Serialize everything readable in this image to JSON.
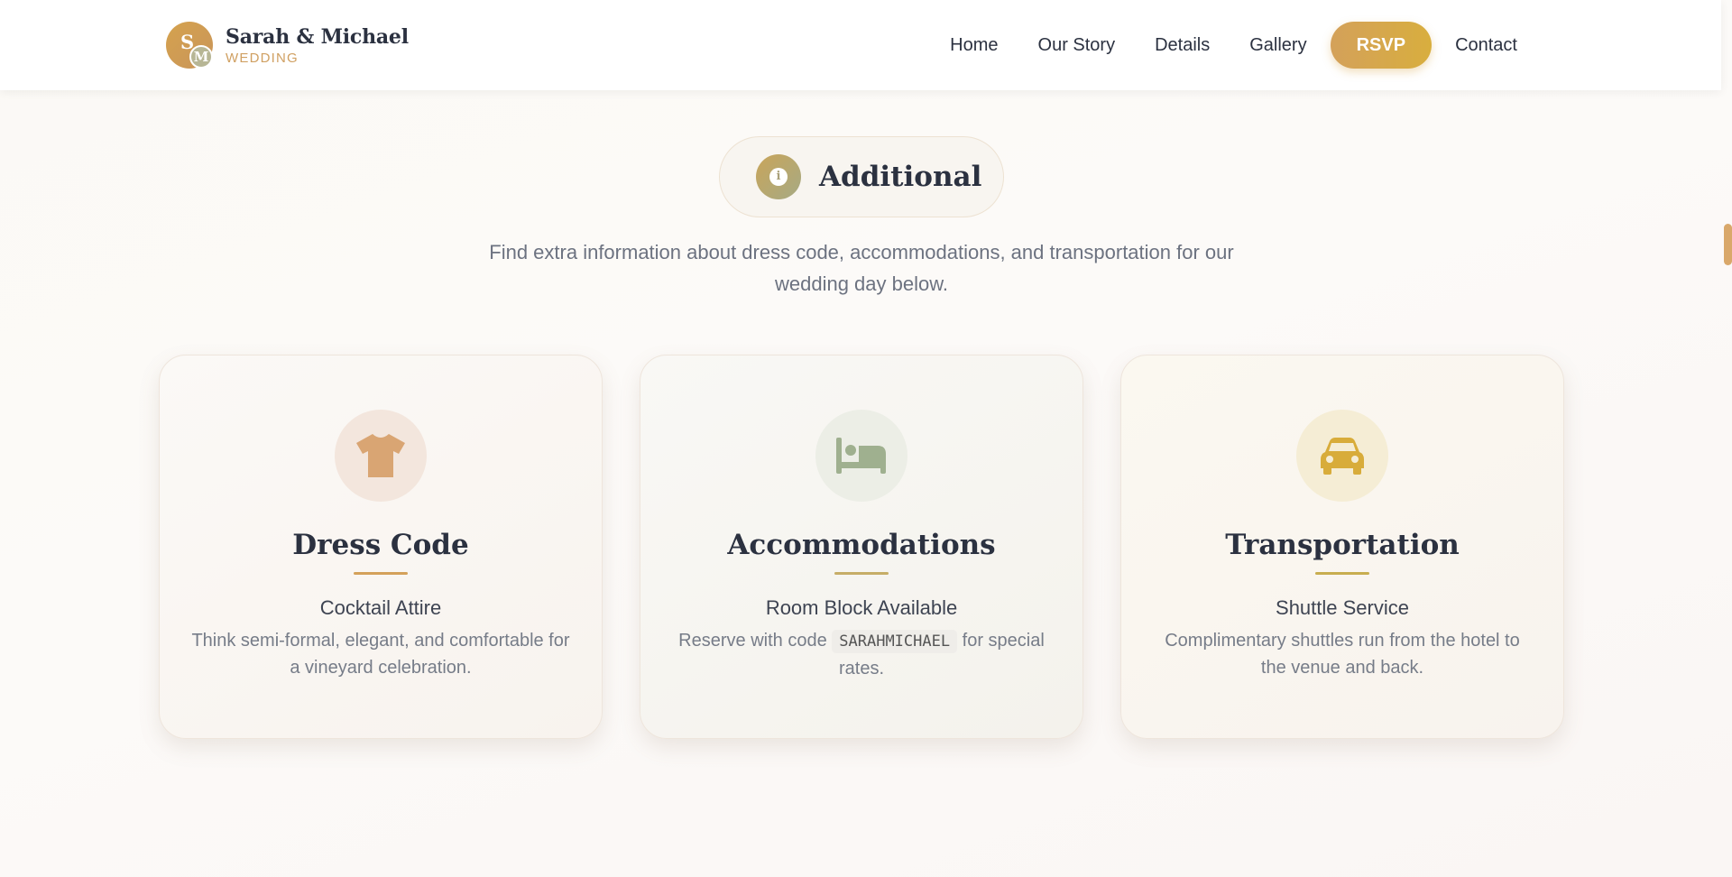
{
  "header": {
    "monogram_first": "S",
    "monogram_second": "M",
    "couple_name": "Sarah & Michael",
    "subtitle": "WEDDING",
    "nav": {
      "home": "Home",
      "story": "Our Story",
      "details": "Details",
      "gallery": "Gallery",
      "rsvp": "RSVP",
      "contact": "Contact"
    }
  },
  "section": {
    "icon": "info-icon",
    "title": "Additional",
    "intro": "Find extra information about dress code, accommodations, and transportation for our wedding day below."
  },
  "cards": [
    {
      "icon": "shirt-icon",
      "icon_color": "#d9a573",
      "title": "Dress Code",
      "subtitle": "Cocktail Attire",
      "description": "Think semi-formal, elegant, and comfortable for a vineyard celebration."
    },
    {
      "icon": "bed-icon",
      "icon_color": "#9fb08f",
      "title": "Accommodations",
      "subtitle": "Room Block Available",
      "description_before": "Reserve with code",
      "code": "SARAHMICHAEL",
      "description_after": "for special rates."
    },
    {
      "icon": "car-icon",
      "icon_color": "#d8ac3a",
      "title": "Transportation",
      "subtitle": "Shuttle Service",
      "description": "Complimentary shuttles run from the hotel to the venue and back."
    }
  ],
  "colors": {
    "accent": "#d4a15a",
    "rsvp_gradient_end": "#d8ae3e",
    "text_dark": "#2b3140",
    "text_muted": "#6c7280"
  }
}
